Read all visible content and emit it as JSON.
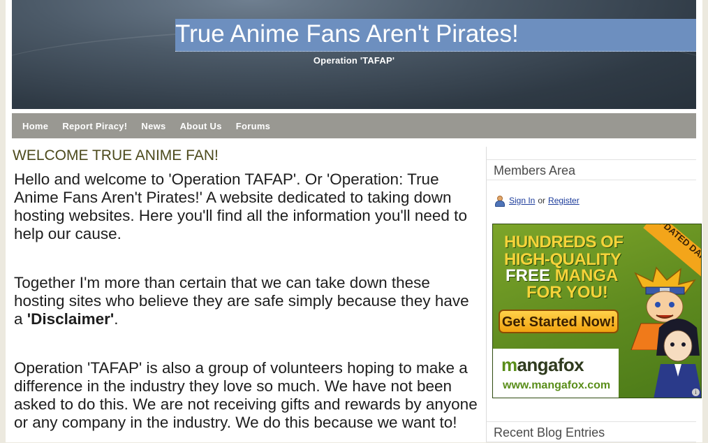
{
  "header": {
    "title": "True Anime Fans Aren't Pirates!",
    "tagline": "Operation 'TAFAP'"
  },
  "nav": {
    "items": [
      {
        "label": "Home"
      },
      {
        "label": "Report Piracy!"
      },
      {
        "label": "News"
      },
      {
        "label": "About Us"
      },
      {
        "label": "Forums"
      }
    ]
  },
  "main": {
    "heading": "WELCOME TRUE ANIME FAN!",
    "p1": "Hello and welcome to 'Operation TAFAP'. Or 'Operation: True Anime Fans Aren't Pirates!' A website dedicated to taking down hosting websites. Here you'll find all the information you'll need to help our cause.",
    "p2_before": "Together I'm more than certain that we can take down these hosting sites who believe they are safe simply because they have a ",
    "p2_bold": "'Disclaimer'",
    "p2_after": ".",
    "p3": "Operation 'TAFAP' is also a group of volunteers hoping to make a difference in the industry they love so much. We have not been asked to do this. We are not receiving gifts and rewards by anyone or any company in the industry. We do this because we want to!"
  },
  "sidebar": {
    "members_title": "Members Area",
    "sign_in": "Sign In",
    "or": "or",
    "register": "Register",
    "recent_title": "Recent Blog Entries"
  },
  "ad": {
    "line1": "HUNDREDS OF",
    "line2": "HIGH-QUALITY",
    "line3_free": "FREE",
    "line3_manga": "MANGA",
    "line4": "FOR YOU!",
    "ribbon": "UPDATED DAILY",
    "cta": "Get Started Now!",
    "logo_m": "m",
    "logo_rest": "angafox",
    "url": "www.mangafox.com",
    "info": "i"
  },
  "colors": {
    "header_title_bg": "#6d8fbf",
    "nav_bg": "#999892",
    "heading": "#4c4a1c",
    "link": "#1a3a9a",
    "ad_green": "#5e8a1f",
    "ad_yellow": "#f6d33a"
  }
}
